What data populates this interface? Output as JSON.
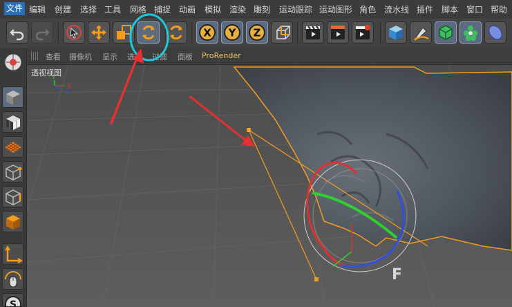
{
  "menubar": {
    "items": [
      "文件",
      "编辑",
      "创建",
      "选择",
      "工具",
      "网格",
      "捕捉",
      "动画",
      "模拟",
      "渲染",
      "雕刻",
      "运动跟踪",
      "运动图形",
      "角色",
      "流水线",
      "插件",
      "脚本",
      "窗口",
      "帮助"
    ],
    "active_index": 0
  },
  "toolbar": {
    "buttons": [
      {
        "name": "undo-button",
        "icon": "undo-icon"
      },
      {
        "name": "redo-button",
        "icon": "redo-icon"
      },
      {
        "name": "live-selection-button",
        "icon": "cursor-selection-icon"
      },
      {
        "name": "move-button",
        "icon": "move-arrows-icon"
      },
      {
        "name": "scale-button",
        "icon": "scale-icon"
      },
      {
        "name": "rotate-button",
        "icon": "rotate-icon"
      },
      {
        "name": "rotate-recent-button",
        "icon": "rotate-icon"
      },
      {
        "name": "x-axis-button",
        "icon": "x-axis-icon",
        "label": "X"
      },
      {
        "name": "y-axis-button",
        "icon": "y-axis-icon",
        "label": "Y"
      },
      {
        "name": "z-axis-button",
        "icon": "z-axis-icon",
        "label": "Z"
      },
      {
        "name": "coordinate-system-button",
        "icon": "axis-icon"
      },
      {
        "name": "render-view-button",
        "icon": "clapper-icon"
      },
      {
        "name": "render-picture-viewer-button",
        "icon": "clapper-icon"
      },
      {
        "name": "render-settings-button",
        "icon": "clapper-gear-icon"
      },
      {
        "name": "cube-button",
        "icon": "cube-icon"
      },
      {
        "name": "pen-button",
        "icon": "pen-icon"
      },
      {
        "name": "subdivision-button",
        "icon": "subdivision-icon"
      },
      {
        "name": "cloner-button",
        "icon": "cloner-icon"
      },
      {
        "name": "deformer-button",
        "icon": "deformer-icon"
      }
    ],
    "selected": "rotate-button"
  },
  "viewport": {
    "menu": [
      "查看",
      "摄像机",
      "显示",
      "选项",
      "过滤",
      "面板",
      "ProRender"
    ],
    "label": "透视视图",
    "axis_labels": {
      "x": "X",
      "y": "Y",
      "z": "Z"
    }
  },
  "left_toolbar": {
    "buttons": [
      "make-editable-button",
      "model-mode-button",
      "texture-mode-button",
      "workplane-button",
      "points-mode-button",
      "edges-mode-button",
      "polygons-mode-button",
      "axis-mode-button",
      "tweak-button",
      "snap-button"
    ]
  },
  "colors": {
    "accent": "#2a6fb5",
    "annotation_red": "#e83030",
    "annotation_cyan": "#1fc8d8",
    "orange_highlight": "#f39c1e",
    "x_axis": "#e03030",
    "y_axis": "#30d030",
    "z_axis": "#3050e0"
  }
}
